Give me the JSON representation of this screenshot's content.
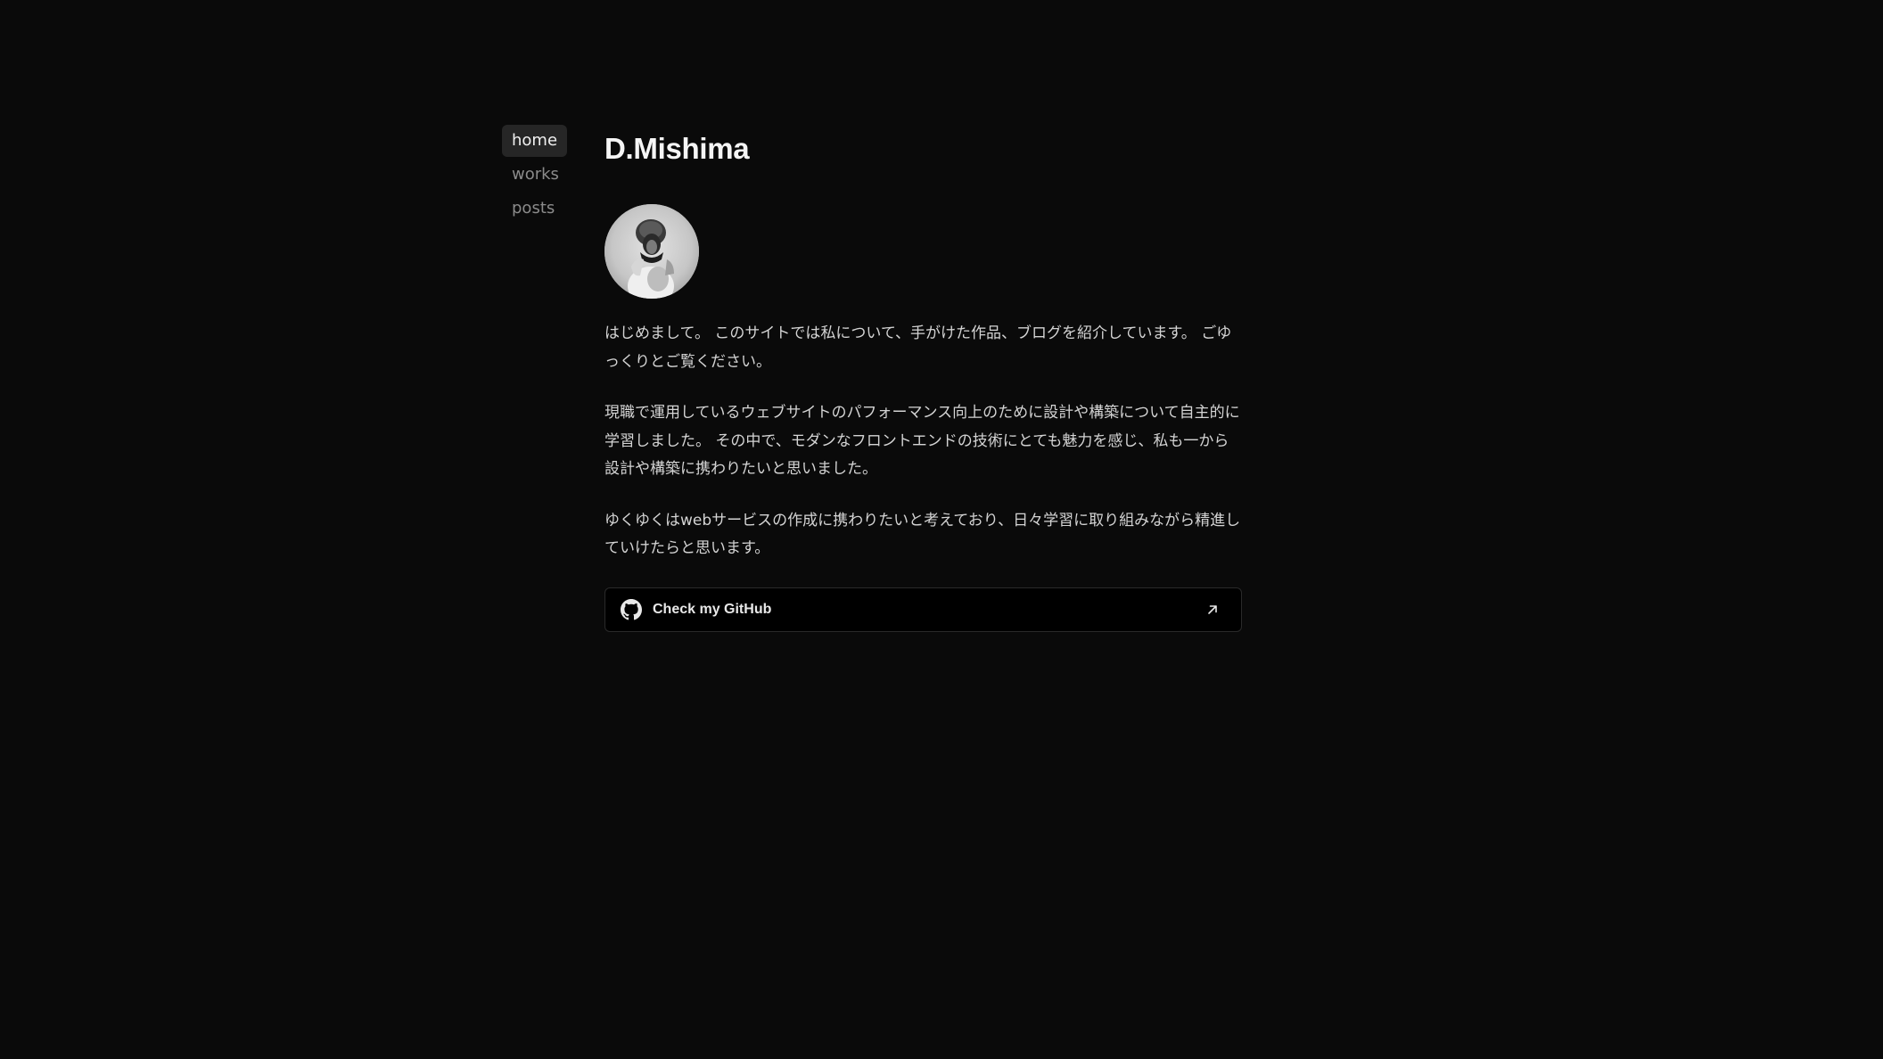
{
  "nav": {
    "items": [
      {
        "label": "home",
        "active": true
      },
      {
        "label": "works",
        "active": false
      },
      {
        "label": "posts",
        "active": false
      }
    ]
  },
  "main": {
    "title": "D.Mishima",
    "avatar_icon": "profile-photo",
    "paragraphs": [
      "はじめまして。 このサイトでは私について、手がけた作品、ブログを紹介しています。 ごゆっくりとご覧ください。",
      "現職で運用しているウェブサイトのパフォーマンス向上のために設計や構築について自主的に学習しました。 その中で、モダンなフロントエンドの技術にとても魅力を感じ、私も一から設計や構築に携わりたいと思いました。",
      "ゆくゆくはwebサービスの作成に携わりたいと考えており、日々学習に取り組みながら精進していけたらと思います。"
    ],
    "github": {
      "label": "Check my GitHub",
      "icon": "github-icon",
      "arrow_icon": "arrow-up-right-icon"
    }
  },
  "colors": {
    "background": "#0a0a0a",
    "nav_active_bg": "#262626",
    "text": "#d4d4d4",
    "muted": "#8b8b8b",
    "card_bg": "#000000",
    "card_border": "#2a2a2a"
  }
}
